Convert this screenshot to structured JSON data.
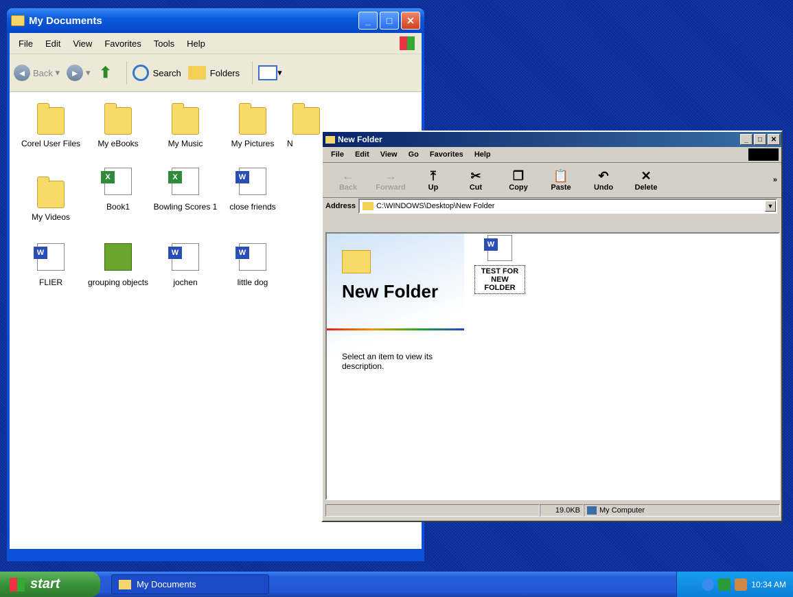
{
  "my_documents": {
    "title": "My Documents",
    "menu": [
      "File",
      "Edit",
      "View",
      "Favorites",
      "Tools",
      "Help"
    ],
    "toolbar": {
      "back": "Back",
      "search": "Search",
      "folders": "Folders"
    },
    "items": [
      {
        "label": "Corel User Files",
        "type": "folder"
      },
      {
        "label": "My eBooks",
        "type": "folder"
      },
      {
        "label": "My Music",
        "type": "folder"
      },
      {
        "label": "My Pictures",
        "type": "folder"
      },
      {
        "label": "N",
        "type": "folder"
      },
      {
        "label": "My Videos",
        "type": "folder"
      },
      {
        "label": "Book1",
        "type": "xls"
      },
      {
        "label": "Bowling Scores 1",
        "type": "xls"
      },
      {
        "label": "close friends",
        "type": "word"
      },
      {
        "label": "FLIER",
        "type": "word"
      },
      {
        "label": "grouping objects",
        "type": "pub"
      },
      {
        "label": "jochen",
        "type": "word"
      },
      {
        "label": "little dog",
        "type": "word"
      }
    ]
  },
  "new_folder": {
    "title": "New Folder",
    "menu": [
      "File",
      "Edit",
      "View",
      "Go",
      "Favorites",
      "Help"
    ],
    "toolbar": [
      "Back",
      "Forward",
      "Up",
      "Cut",
      "Copy",
      "Paste",
      "Undo",
      "Delete"
    ],
    "address_label": "Address",
    "address": "C:\\WINDOWS\\Desktop\\New Folder",
    "webview_title": "New Folder",
    "webview_desc": "Select an item to view its description.",
    "file_label": "TEST FOR NEW FOLDER",
    "status_size": "19.0KB",
    "status_zone": "My Computer"
  },
  "taskbar": {
    "start": "start",
    "item": "My Documents",
    "clock": "10:34 AM"
  }
}
